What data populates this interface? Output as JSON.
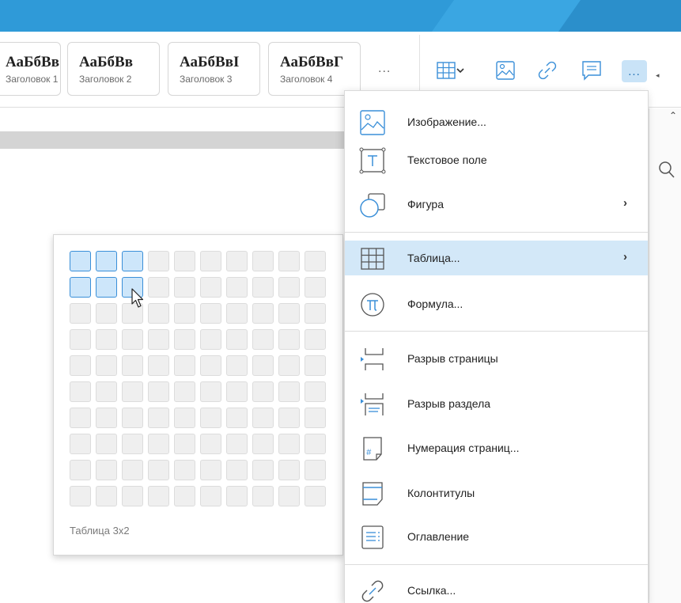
{
  "styles": [
    {
      "sample": "АаБбВв",
      "name": "Заголовок 1"
    },
    {
      "sample": "АаБбВв",
      "name": "Заголовок 2"
    },
    {
      "sample": "АаБбВвI",
      "name": "Заголовок 3"
    },
    {
      "sample": "АаБбВвГ",
      "name": "Заголовок 4"
    }
  ],
  "toolbar": {
    "more_styles": "...",
    "more_button": "...",
    "icons": [
      "table-icon",
      "chevron-down-icon",
      "image-icon",
      "link-icon",
      "comment-icon",
      "more-icon"
    ]
  },
  "table_grid": {
    "columns": 10,
    "rows": 10,
    "selected_columns": 3,
    "selected_rows": 2,
    "label": "Таблица 3x2"
  },
  "insert_menu": {
    "items": [
      {
        "label": "Изображение...",
        "icon": "image-icon",
        "submenu": false,
        "active": false
      },
      {
        "label": "Текстовое поле",
        "icon": "text-box-icon",
        "submenu": false,
        "active": false
      },
      {
        "label": "Фигура",
        "icon": "shape-icon",
        "submenu": true,
        "active": false
      },
      {
        "label": "Таблица...",
        "icon": "table-icon",
        "submenu": true,
        "active": true
      },
      {
        "label": "Формула...",
        "icon": "formula-icon",
        "submenu": false,
        "active": false
      },
      {
        "label": "Разрыв страницы",
        "icon": "page-break-icon",
        "submenu": false,
        "active": false
      },
      {
        "label": "Разрыв раздела",
        "icon": "section-break-icon",
        "submenu": false,
        "active": false
      },
      {
        "label": "Нумерация страниц...",
        "icon": "page-numbering-icon",
        "submenu": false,
        "active": false
      },
      {
        "label": "Колонтитулы",
        "icon": "header-footer-icon",
        "submenu": false,
        "active": false
      },
      {
        "label": "Оглавление",
        "icon": "table-of-contents-icon",
        "submenu": false,
        "active": false
      },
      {
        "label": "Ссылка...",
        "icon": "link-icon",
        "submenu": false,
        "active": false
      }
    ],
    "submenu_arrow": "›"
  },
  "colors": {
    "titlebar": "#2f9ad8",
    "accent": "#3a8fd8",
    "selection": "#cde6fa",
    "menu_active": "#d3e8f8"
  }
}
